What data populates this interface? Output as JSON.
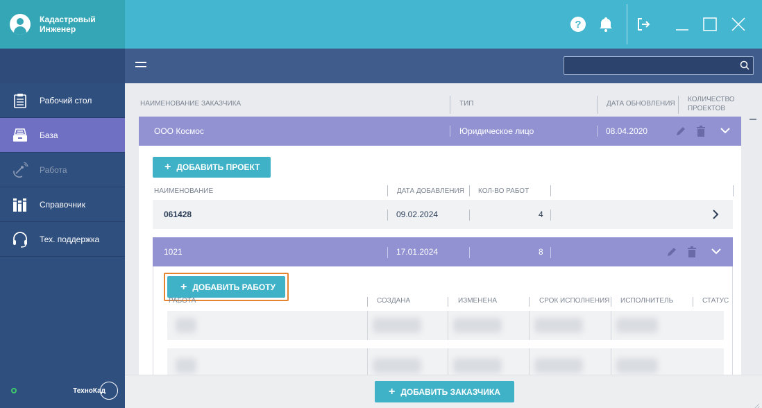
{
  "app": {
    "user_name": "Кадастровый Инженер",
    "brand": "ТехноКад"
  },
  "colors": {
    "accent": "#44b6cf",
    "sidebar": "#2f4f7f",
    "active_nav": "#6f6fc4",
    "row_highlight": "#9292d2",
    "focus": "#e6832e"
  },
  "sidebar": {
    "items": [
      {
        "label": "Рабочий стол",
        "icon": "clipboard-icon",
        "active": false,
        "disabled": false
      },
      {
        "label": "База",
        "icon": "database-icon",
        "active": true,
        "disabled": false
      },
      {
        "label": "Работа",
        "icon": "satellite-icon",
        "active": false,
        "disabled": true
      },
      {
        "label": "Справочник",
        "icon": "books-icon",
        "active": false,
        "disabled": false
      },
      {
        "label": "Тех. поддержка",
        "icon": "headset-icon",
        "active": false,
        "disabled": false
      }
    ]
  },
  "topbar": {
    "icons": [
      "help-icon",
      "notification-bell-icon",
      "logout-icon",
      "minimize-icon",
      "maximize-icon",
      "close-icon"
    ]
  },
  "search": {
    "value": "",
    "placeholder": ""
  },
  "table": {
    "columns": [
      "НАИМЕНОВАНИЕ ЗАКАЗЧИКА",
      "ТИП",
      "ДАТА ОБНОВЛЕНИЯ",
      "КОЛИЧЕСТВО ПРОЕКТОВ"
    ]
  },
  "customer": {
    "name": "ООО Космос",
    "type": "Юридическое лицо",
    "updated": "08.04.2020",
    "add_project_label": "ДОБАВИТЬ ПРОЕКТ"
  },
  "projects": {
    "columns": [
      "НАИМЕНОВАНИЕ",
      "ДАТА ДОБАВЛЕНИЯ",
      "КОЛ-ВО РАБОТ"
    ],
    "rows": [
      {
        "name": "061428",
        "date": "09.02.2024",
        "count": "4"
      },
      {
        "name": "1021",
        "date": "17.01.2024",
        "count": "8"
      }
    ]
  },
  "works": {
    "add_work_label": "ДОБАВИТЬ РАБОТУ",
    "columns": [
      "РАБОТА",
      "СОЗДАНА",
      "ИЗМЕНЕНА",
      "СРОК ИСПОЛНЕНИЯ",
      "ИСПОЛНИТЕЛЬ",
      "СТАТУС"
    ]
  },
  "footer": {
    "add_customer_label": "ДОБАВИТЬ ЗАКАЗЧИКА"
  }
}
